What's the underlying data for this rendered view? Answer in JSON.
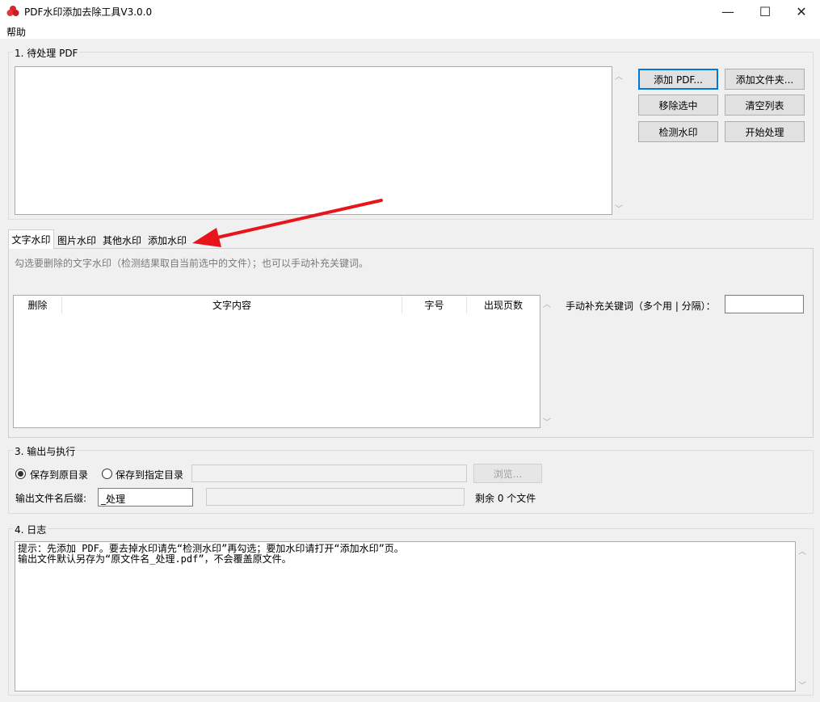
{
  "window": {
    "title": "PDF水印添加去除工具V3.0.0",
    "minimize": "—",
    "maximize": "☐",
    "close": "✕"
  },
  "menu": {
    "help": "帮助"
  },
  "section1": {
    "title": "1. 待处理 PDF",
    "buttons": {
      "add_pdf": "添加 PDF...",
      "add_folder": "添加文件夹...",
      "remove_selected": "移除选中",
      "clear_list": "清空列表",
      "detect_watermark": "检测水印",
      "start_process": "开始处理"
    }
  },
  "tabs": [
    "文字水印",
    "图片水印",
    "其他水印",
    "添加水印"
  ],
  "text_watermark": {
    "hint": "勾选要删除的文字水印（检测结果取自当前选中的文件）；也可以手动补充关键词。",
    "columns": [
      "删除",
      "文字内容",
      "字号",
      "出现页数"
    ],
    "manual_keyword_label": "手动补充关键词（多个用 | 分隔）：",
    "manual_keyword_value": ""
  },
  "section3": {
    "title": "3. 输出与执行",
    "save_original": "保存到原目录",
    "save_specified": "保存到指定目录",
    "browse": "浏览...",
    "suffix_label": "输出文件名后缀:",
    "suffix_value": "_处理",
    "remaining": "剩余 0 个文件"
  },
  "section4": {
    "title": "4. 日志",
    "log": "提示：先添加 PDF。要去掉水印请先“检测水印”再勾选；要加水印请打开“添加水印”页。\n输出文件默认另存为“原文件名_处理.pdf”，不会覆盖原文件。"
  },
  "colors": {
    "accent": "#0078d7",
    "arrow": "#e8141b"
  }
}
